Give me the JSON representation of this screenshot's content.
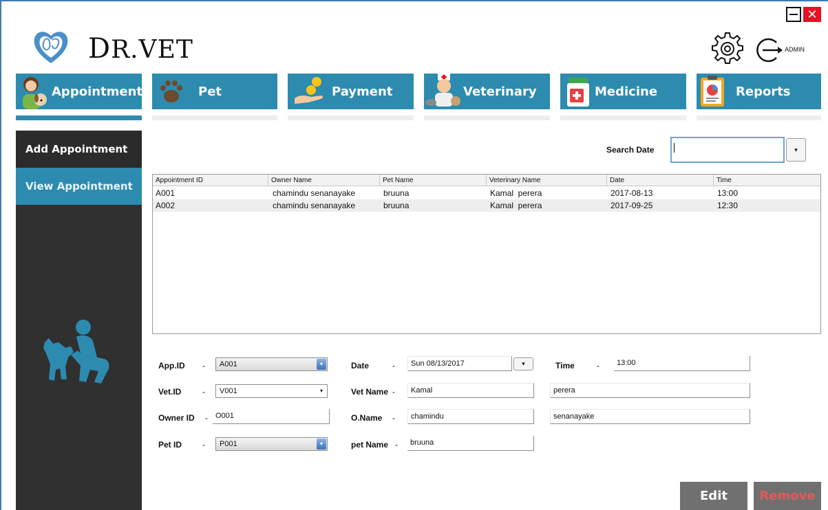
{
  "header": {
    "brand_first": "D",
    "brand_rest": "R.VET",
    "admin_label": "ADMIN",
    "minimize_icon": "minimize-icon",
    "close_symbol": "✕",
    "settings_icon": "gear-icon",
    "logout_icon": "logout-icon"
  },
  "tabs": [
    {
      "label": "Appointment",
      "icon": "woman-dog-icon",
      "active": true
    },
    {
      "label": "Pet",
      "icon": "paw-icon",
      "active": false
    },
    {
      "label": "Payment",
      "icon": "coin-hand-icon",
      "active": false
    },
    {
      "label": "Veterinary",
      "icon": "vet-doctor-icon",
      "active": false
    },
    {
      "label": "Medicine",
      "icon": "medicine-icon",
      "active": false
    },
    {
      "label": "Reports",
      "icon": "report-icon",
      "active": false
    }
  ],
  "sidebar": {
    "items": [
      {
        "label": "Add Appointment"
      },
      {
        "label": "View Appointment",
        "selected": true
      }
    ]
  },
  "search": {
    "label": "Search Date",
    "value": "",
    "dropdown_symbol": "▾"
  },
  "table": {
    "columns": [
      "Appointment ID",
      "Owner Name",
      "Pet Name",
      "Veterinary Name",
      "Date",
      "Time"
    ],
    "rows": [
      [
        "A001",
        "chamindu senanayake",
        "bruuna",
        "Kamal  perera",
        "2017-08-13",
        "13:00"
      ],
      [
        "A002",
        "chamindu senanayake",
        "bruuna",
        "Kamal  perera",
        "2017-09-25",
        "12:30"
      ]
    ]
  },
  "form": {
    "app_id": {
      "label": "App.ID",
      "value": "A001"
    },
    "vet_id": {
      "label": "Vet.ID",
      "value": "V001"
    },
    "owner_id": {
      "label": "Owner ID",
      "value": "O001"
    },
    "pet_id": {
      "label": "Pet ID",
      "value": "P001"
    },
    "date": {
      "label": "Date",
      "value": "Sun 08/13/2017"
    },
    "vet_name": {
      "label": "Vet Name",
      "first": "Kamal",
      "last": "perera"
    },
    "owner_name": {
      "label": "O.Name",
      "first": "chamindu",
      "last": "senanayake"
    },
    "pet_name": {
      "label": "pet Name",
      "value": "bruuna"
    },
    "time": {
      "label": "Time",
      "value": "13:00"
    },
    "dash": "-",
    "arrow": "▾"
  },
  "actions": {
    "edit": "Edit",
    "remove": "Remove"
  },
  "colors": {
    "accent": "#2d8bb0",
    "sidebar": "#303030",
    "button": "#707070",
    "remove_text": "#e05a5a",
    "close_red": "#e81123"
  }
}
